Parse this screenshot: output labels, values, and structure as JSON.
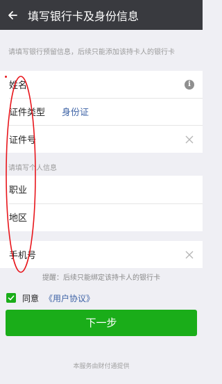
{
  "header": {
    "title": "填写银行卡及身份信息"
  },
  "top_hint": "请填写银行预留信息，后续只能添加该持卡人的银行卡",
  "identity": {
    "name_label": "姓名",
    "id_type_label": "证件类型",
    "id_type_value": "身份证",
    "id_number_label": "证件号"
  },
  "personal": {
    "section_hint": "请填写个人信息",
    "occupation_label": "职业",
    "region_label": "地区"
  },
  "phone": {
    "label": "手机号"
  },
  "tip": "提醒：后续只能绑定该持卡人的银行卡",
  "agreement": {
    "agree_text": "同意",
    "link_text": "《用户协议》",
    "checked": true
  },
  "next_button": "下一步",
  "footer": "本服务由财付通提供",
  "colors": {
    "titlebar": "#393a3f",
    "accent_green": "#1aad19",
    "link_blue": "#3e63a6",
    "annotation_red": "#e8151b"
  },
  "icons": [
    "back-arrow-icon",
    "info-icon",
    "clear-icon",
    "checkbox-checked-icon"
  ]
}
